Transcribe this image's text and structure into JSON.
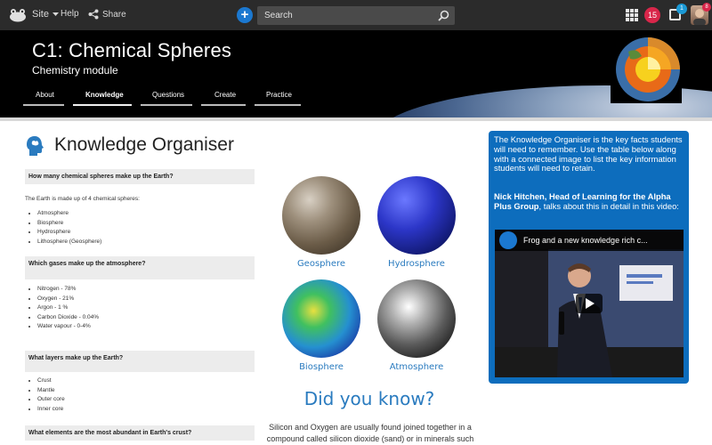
{
  "topbar": {
    "site_label": "Site",
    "help_label": "Help",
    "share_label": "Share",
    "search_placeholder": "Search",
    "notification_count": "15",
    "message_count": "1",
    "avatar_count": "8"
  },
  "banner": {
    "title": "C1: Chemical Spheres",
    "subtitle": "Chemistry module",
    "tabs": [
      {
        "label": "About"
      },
      {
        "label": "Knowledge"
      },
      {
        "label": "Questions"
      },
      {
        "label": "Create"
      },
      {
        "label": "Practice"
      }
    ],
    "active_tab": "Knowledge"
  },
  "main": {
    "title": "Knowledge Organiser",
    "qa": [
      {
        "question": "How many chemical spheres make up the Earth?",
        "answer_text": "The Earth is made up of 4 chemical spheres:",
        "items": [
          "Atmosphere",
          "Biosphere",
          "Hydrosphere",
          "Lithosphere (Geosphere)"
        ]
      },
      {
        "question": "Which gases make up the atmosphere?",
        "items": [
          "Nitrogen - 78%",
          "Oxygen - 21%",
          "Argon - 1 %",
          "Carbon Dioxide - 0.04%",
          "Water vapour - 0-4%"
        ]
      },
      {
        "question": "What layers make up the Earth?",
        "items": [
          "Crust",
          "Mantle",
          "Outer core",
          "Inner core"
        ]
      },
      {
        "question": "What elements are the most abundant in Earth's crust?"
      }
    ],
    "spheres": [
      {
        "label": "Geosphere"
      },
      {
        "label": "Hydrosphere"
      },
      {
        "label": "Biosphere"
      },
      {
        "label": "Atmosphere"
      }
    ],
    "did_you_know_title": "Did you know?",
    "did_you_know_text": "Silicon and Oxygen are usually found joined together in a compound called silicon dioxide (sand) or in minerals such as"
  },
  "panel": {
    "intro": "The Knowledge Organiser is the key facts students will need to remember.  Use the table below along with a connected image to list the key information students will need to retain.",
    "author_bold": "Nick Hitchen, Head of Learning for the Alpha Plus Group",
    "author_rest": ", talks about this in detail in this video:",
    "video_title": "Frog and a new knowledge rich c..."
  }
}
